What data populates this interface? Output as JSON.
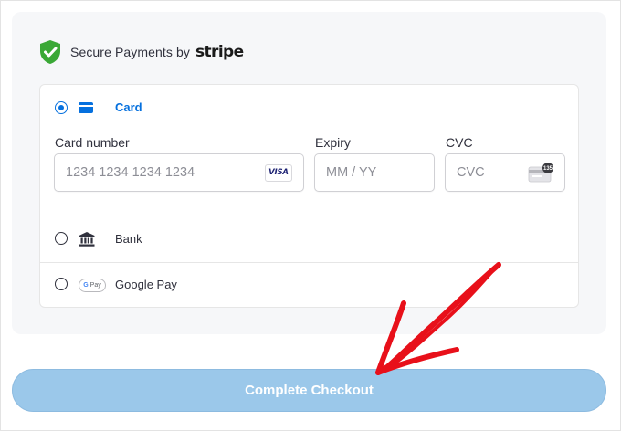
{
  "header": {
    "secure_text": "Secure Payments by",
    "brand": "stripe"
  },
  "payment_methods": {
    "card": {
      "label": "Card",
      "selected": true,
      "card_number": {
        "label": "Card number",
        "placeholder": "1234 1234 1234 1234",
        "brand_badge": "VISA"
      },
      "expiry": {
        "label": "Expiry",
        "placeholder": "MM / YY"
      },
      "cvc": {
        "label": "CVC",
        "placeholder": "CVC",
        "badge_number": "135"
      }
    },
    "bank": {
      "label": "Bank",
      "selected": false
    },
    "google_pay": {
      "label": "Google Pay",
      "selected": false,
      "badge_text": "Pay",
      "badge_letter": "G"
    }
  },
  "checkout": {
    "button_label": "Complete Checkout"
  },
  "colors": {
    "accent": "#0570de",
    "shield": "#3aa836",
    "button": "#9bc8ea",
    "annotation_arrow": "#e8101a",
    "panel_bg": "#f6f7f9"
  },
  "icons": [
    "shield-check-icon",
    "card-icon",
    "visa-icon",
    "cvc-card-icon",
    "bank-icon",
    "google-pay-icon",
    "red-arrow-annotation"
  ]
}
